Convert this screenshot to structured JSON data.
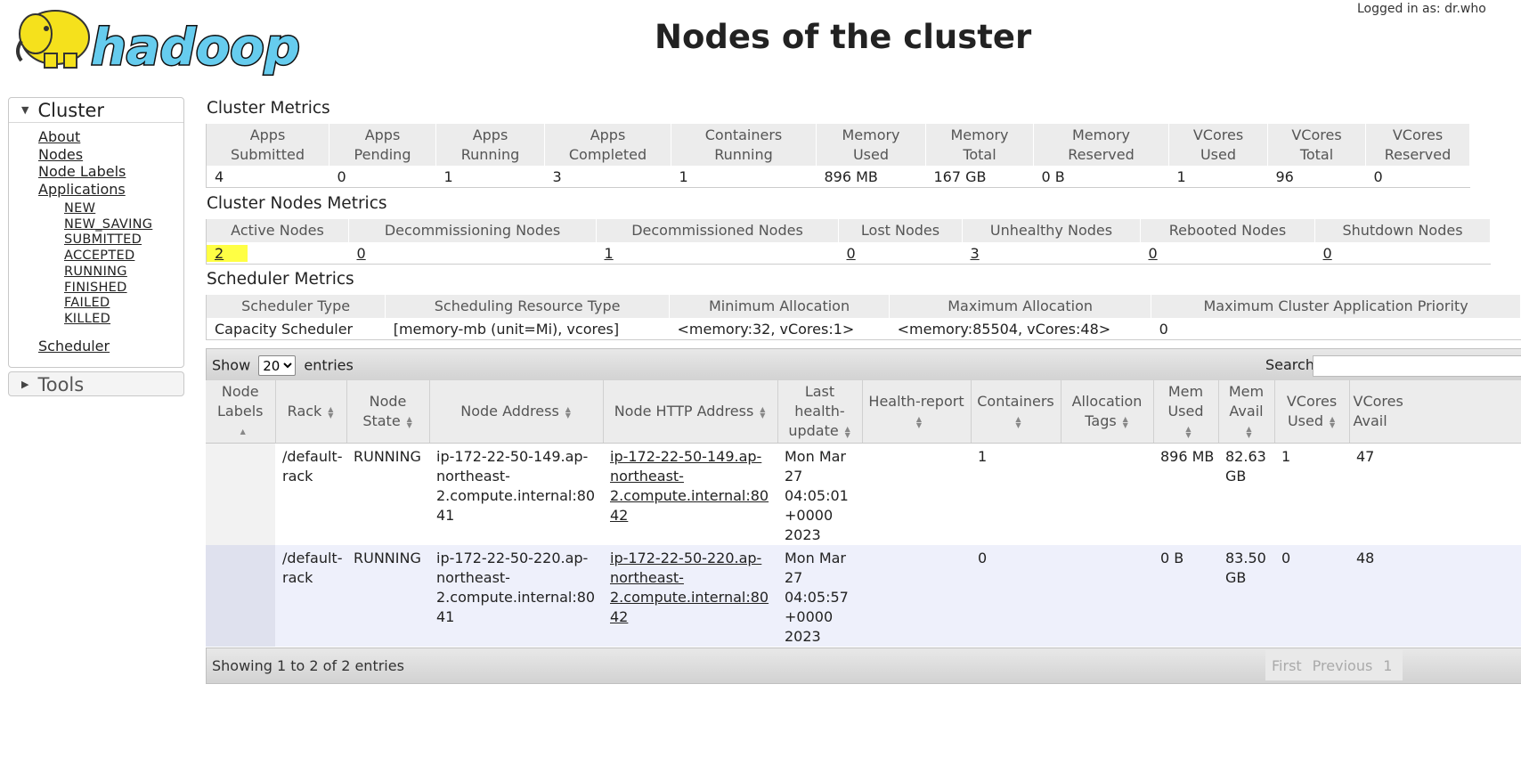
{
  "header": {
    "logo_text": "hadoop",
    "title": "Nodes of the cluster",
    "logged_in": "Logged in as: dr.who"
  },
  "sidebar": {
    "cluster_title": "Cluster",
    "links": [
      "About",
      "Nodes",
      "Node Labels",
      "Applications"
    ],
    "app_states": [
      "NEW",
      "NEW_SAVING",
      "SUBMITTED",
      "ACCEPTED",
      "RUNNING",
      "FINISHED",
      "FAILED",
      "KILLED"
    ],
    "scheduler": "Scheduler",
    "tools_title": "Tools"
  },
  "cluster_metrics": {
    "title": "Cluster Metrics",
    "headers": [
      [
        "Apps",
        "Submitted"
      ],
      [
        "Apps",
        "Pending"
      ],
      [
        "Apps",
        "Running"
      ],
      [
        "Apps",
        "Completed"
      ],
      [
        "Containers",
        "Running"
      ],
      [
        "Memory",
        "Used"
      ],
      [
        "Memory",
        "Total"
      ],
      [
        "Memory",
        "Reserved"
      ],
      [
        "VCores",
        "Used"
      ],
      [
        "VCores",
        "Total"
      ],
      [
        "VCores",
        "Reserved"
      ]
    ],
    "values": [
      "4",
      "0",
      "1",
      "3",
      "1",
      "896 MB",
      "167 GB",
      "0 B",
      "1",
      "96",
      "0"
    ]
  },
  "cluster_nodes_metrics": {
    "title": "Cluster Nodes Metrics",
    "headers": [
      "Active Nodes",
      "Decommissioning Nodes",
      "Decommissioned Nodes",
      "Lost Nodes",
      "Unhealthy Nodes",
      "Rebooted Nodes",
      "Shutdown Nodes"
    ],
    "values": [
      "2",
      "0",
      "1",
      "0",
      "3",
      "0",
      "0"
    ]
  },
  "scheduler_metrics": {
    "title": "Scheduler Metrics",
    "headers": [
      "Scheduler Type",
      "Scheduling Resource Type",
      "Minimum Allocation",
      "Maximum Allocation",
      "Maximum Cluster Application Priority"
    ],
    "values": [
      "Capacity Scheduler",
      "[memory-mb (unit=Mi), vcores]",
      "<memory:32, vCores:1>",
      "<memory:85504, vCores:48>",
      "0"
    ]
  },
  "table_controls": {
    "show_label": "Show",
    "entries_label": "entries",
    "page_size": "20",
    "search_label": "Search:",
    "search_value": "",
    "info": "Showing 1 to 2 of 2 entries",
    "pager": [
      "First",
      "Previous",
      "1"
    ]
  },
  "nodes_table": {
    "headers": [
      [
        "Node",
        "Labels"
      ],
      [
        "Rack"
      ],
      [
        "Node",
        "State"
      ],
      [
        "Node Address"
      ],
      [
        "Node HTTP Address"
      ],
      [
        "Last",
        "health-",
        "update"
      ],
      [
        "Health-report"
      ],
      [
        "Containers"
      ],
      [
        "Allocation",
        "Tags"
      ],
      [
        "Mem",
        "Used"
      ],
      [
        "Mem",
        "Avail"
      ],
      [
        "VCores",
        "Used"
      ],
      [
        "VCores",
        "Avail"
      ]
    ],
    "rows": [
      {
        "labels": "",
        "rack": "/default-rack",
        "state": "RUNNING",
        "address": "ip-172-22-50-149.ap-northeast-2.compute.internal:8041",
        "http_address": "ip-172-22-50-149.ap-northeast-2.compute.internal:8042",
        "last_update": "Mon Mar 27 04:05:01 +0000 2023",
        "health_report": "",
        "containers": "1",
        "allocation_tags": "",
        "mem_used": "896 MB",
        "mem_avail": "82.63 GB",
        "vcores_used": "1",
        "vcores_avail": "47"
      },
      {
        "labels": "",
        "rack": "/default-rack",
        "state": "RUNNING",
        "address": "ip-172-22-50-220.ap-northeast-2.compute.internal:8041",
        "http_address": "ip-172-22-50-220.ap-northeast-2.compute.internal:8042",
        "last_update": "Mon Mar 27 04:05:57 +0000 2023",
        "health_report": "",
        "containers": "0",
        "allocation_tags": "",
        "mem_used": "0 B",
        "mem_avail": "83.50 GB",
        "vcores_used": "0",
        "vcores_avail": "48"
      }
    ]
  },
  "colors": {
    "highlight": "#ffff44",
    "header_bg": "#ececec",
    "even_row": "#eef0fb",
    "logo_yellow": "#f5e11c",
    "logo_blue": "#66ccee"
  }
}
